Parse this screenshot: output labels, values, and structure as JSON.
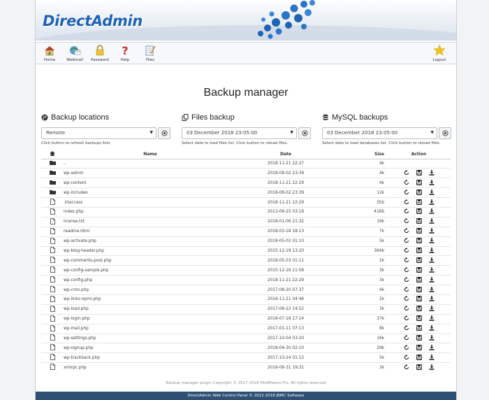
{
  "header": {
    "logo": "DirectAdmin"
  },
  "toolbar": {
    "items": [
      {
        "label": "Home",
        "icon": "home-icon"
      },
      {
        "label": "Webmail",
        "icon": "webmail-icon"
      },
      {
        "label": "Password",
        "icon": "lock-icon"
      },
      {
        "label": "Help",
        "icon": "help-icon"
      },
      {
        "label": "Files",
        "icon": "files-icon"
      }
    ],
    "logout": {
      "label": "Logout",
      "icon": "star-icon"
    }
  },
  "page_title": "Backup manager",
  "sections": {
    "locations": {
      "title": "Backup locations",
      "select_value": "Remote",
      "hint": "Click button to refresh backups lists"
    },
    "files": {
      "title": "Files backup",
      "select_value": "03 December 2018 23:05:00",
      "hint": "Select date to load files list. Click button to reload files."
    },
    "mysql": {
      "title": "MySQL backups",
      "select_value": "03 December 2018 23:05:00",
      "hint": "Select date to load databases list. Click button to reload files."
    }
  },
  "table": {
    "headers": {
      "name": "Name",
      "date": "Date",
      "size": "Size",
      "action": "Action"
    },
    "rows": [
      {
        "type": "folder",
        "name": "..",
        "date": "2018-11-21 22:27",
        "size": "4k",
        "actions": false
      },
      {
        "type": "folder",
        "name": "wp-admin",
        "date": "2018-08-02 23:39",
        "size": "4k",
        "actions": true
      },
      {
        "type": "folder",
        "name": "wp-content",
        "date": "2018-11-21 22:29",
        "size": "4k",
        "actions": true
      },
      {
        "type": "folder",
        "name": "wp-includes",
        "date": "2018-08-02 23:39",
        "size": "12k",
        "actions": true
      },
      {
        "type": "file",
        "name": ".htaccess",
        "date": "2018-11-21 22:29",
        "size": "35b",
        "actions": true
      },
      {
        "type": "file",
        "name": "index.php",
        "date": "2013-09-25 03:18",
        "size": "418b",
        "actions": true
      },
      {
        "type": "file",
        "name": "license.txt",
        "date": "2018-01-06 21:32",
        "size": "19k",
        "actions": true
      },
      {
        "type": "file",
        "name": "readme.html",
        "date": "2018-03-18 18:13",
        "size": "7k",
        "actions": true
      },
      {
        "type": "file",
        "name": "wp-activate.php",
        "date": "2018-05-02 01:10",
        "size": "5k",
        "actions": true
      },
      {
        "type": "file",
        "name": "wp-blog-header.php",
        "date": "2015-12-19 13:20",
        "size": "364b",
        "actions": true
      },
      {
        "type": "file",
        "name": "wp-comments-post.php",
        "date": "2018-05-03 01:11",
        "size": "2k",
        "actions": true
      },
      {
        "type": "file",
        "name": "wp-config-sample.php",
        "date": "2015-12-16 11:58",
        "size": "3k",
        "actions": true
      },
      {
        "type": "file",
        "name": "wp-config.php",
        "date": "2018-11-21 22:29",
        "size": "3k",
        "actions": true
      },
      {
        "type": "file",
        "name": "wp-cron.php",
        "date": "2017-08-20 07:37",
        "size": "4k",
        "actions": true
      },
      {
        "type": "file",
        "name": "wp-links-opml.php",
        "date": "2016-11-21 04:46",
        "size": "2k",
        "actions": true
      },
      {
        "type": "file",
        "name": "wp-load.php",
        "date": "2017-08-22 14:52",
        "size": "3k",
        "actions": true
      },
      {
        "type": "file",
        "name": "wp-login.php",
        "date": "2018-07-16 17:14",
        "size": "37k",
        "actions": true
      },
      {
        "type": "file",
        "name": "wp-mail.php",
        "date": "2017-01-11 07:13",
        "size": "8k",
        "actions": true
      },
      {
        "type": "file",
        "name": "wp-settings.php",
        "date": "2017-10-04 03:20",
        "size": "16k",
        "actions": true
      },
      {
        "type": "file",
        "name": "wp-signup.php",
        "date": "2018-04-30 02:10",
        "size": "29k",
        "actions": true
      },
      {
        "type": "file",
        "name": "wp-trackback.php",
        "date": "2017-10-24 01:12",
        "size": "5k",
        "actions": true
      },
      {
        "type": "file",
        "name": "xmlrpc.php",
        "date": "2016-08-31 19:31",
        "size": "3k",
        "actions": true
      }
    ]
  },
  "footer": {
    "plugin_note": "Backup manager plugin Copyright © 2017-2018 ModMaster.Pro. All rights reserved",
    "copyright": "DirectAdmin Web Control Panel © 2012-2018 JBMC Software"
  },
  "colors": {
    "brand": "#1f63b5",
    "footer_bar": "#2f4f73"
  }
}
